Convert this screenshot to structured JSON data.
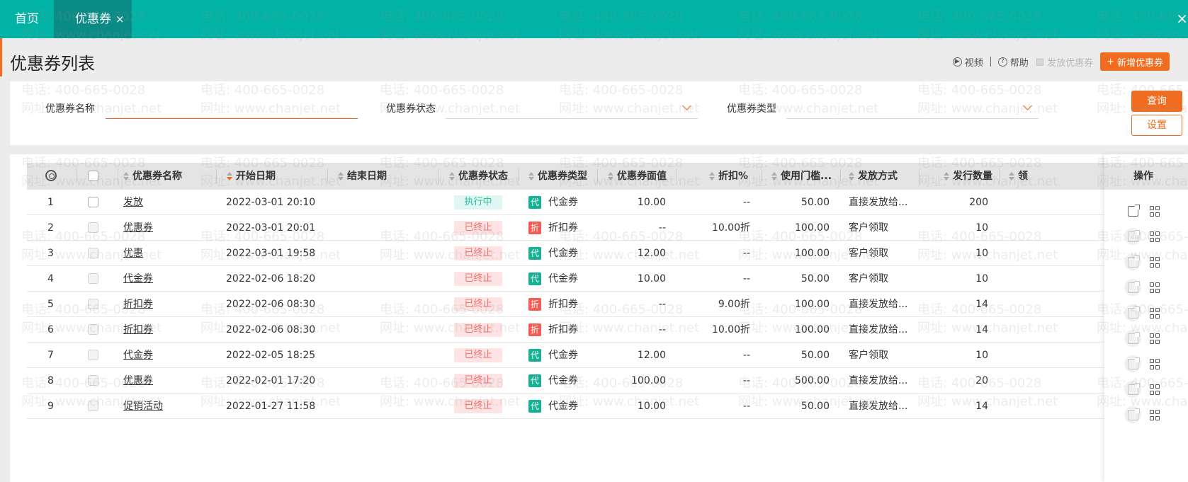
{
  "tabs": {
    "home": "首页",
    "active": "优惠券",
    "close": "×"
  },
  "top_close": "×",
  "page_title": "优惠券列表",
  "toolbar": {
    "video": "视频",
    "help": "帮助",
    "issue": "发放优惠券",
    "add": "新增优惠券"
  },
  "filters": {
    "name_label": "优惠券名称",
    "status_label": "优惠券状态",
    "type_label": "优惠券类型",
    "query": "查询",
    "settings": "设置"
  },
  "columns": {
    "name": "优惠券名称",
    "start": "开始日期",
    "end": "结束日期",
    "status": "优惠券状态",
    "type": "优惠券类型",
    "face": "优惠券面值",
    "discount": "折扣%",
    "threshold": "使用门槛...",
    "method": "发放方式",
    "qty": "发行数量",
    "extra": "领",
    "ops": "操作"
  },
  "rows": [
    {
      "idx": "1",
      "name": "发放",
      "start": "2022-03-01 20:10",
      "status": "执行中",
      "status_kind": "run",
      "type_icon": "代",
      "type_kind": "dai",
      "type": "代金券",
      "face": "10.00",
      "discount": "--",
      "threshold": "50.00",
      "method": "直接发放给...",
      "qty": "200"
    },
    {
      "idx": "2",
      "name": "优惠券",
      "start": "2022-03-01 20:01",
      "status": "已终止",
      "status_kind": "stop",
      "type_icon": "折",
      "type_kind": "zhe",
      "type": "折扣券",
      "face": "--",
      "discount": "10.00折",
      "threshold": "100.00",
      "method": "客户领取",
      "qty": "10"
    },
    {
      "idx": "3",
      "name": "优惠",
      "start": "2022-03-01 19:58",
      "status": "已终止",
      "status_kind": "stop",
      "type_icon": "代",
      "type_kind": "dai",
      "type": "代金券",
      "face": "12.00",
      "discount": "--",
      "threshold": "100.00",
      "method": "客户领取",
      "qty": "10"
    },
    {
      "idx": "4",
      "name": "代金券",
      "start": "2022-02-06 18:20",
      "status": "已终止",
      "status_kind": "stop",
      "type_icon": "代",
      "type_kind": "dai",
      "type": "代金券",
      "face": "10.00",
      "discount": "--",
      "threshold": "50.00",
      "method": "客户领取",
      "qty": "10"
    },
    {
      "idx": "5",
      "name": "折扣券",
      "start": "2022-02-06 08:30",
      "status": "已终止",
      "status_kind": "stop",
      "type_icon": "折",
      "type_kind": "zhe",
      "type": "折扣券",
      "face": "--",
      "discount": "9.00折",
      "threshold": "100.00",
      "method": "直接发放给...",
      "qty": "14"
    },
    {
      "idx": "6",
      "name": "折扣券",
      "start": "2022-02-06 08:30",
      "status": "已终止",
      "status_kind": "stop",
      "type_icon": "折",
      "type_kind": "zhe",
      "type": "折扣券",
      "face": "--",
      "discount": "10.00折",
      "threshold": "100.00",
      "method": "直接发放给...",
      "qty": "14"
    },
    {
      "idx": "7",
      "name": "代金券",
      "start": "2022-02-05 18:25",
      "status": "已终止",
      "status_kind": "stop",
      "type_icon": "代",
      "type_kind": "dai",
      "type": "代金券",
      "face": "12.00",
      "discount": "--",
      "threshold": "50.00",
      "method": "客户领取",
      "qty": "10"
    },
    {
      "idx": "8",
      "name": "优惠券",
      "start": "2022-02-01 17:20",
      "status": "已终止",
      "status_kind": "stop",
      "type_icon": "代",
      "type_kind": "dai",
      "type": "代金券",
      "face": "100.00",
      "discount": "--",
      "threshold": "500.00",
      "method": "直接发放给...",
      "qty": "20"
    },
    {
      "idx": "9",
      "name": "促销活动",
      "start": "2022-01-27 11:58",
      "status": "已终止",
      "status_kind": "stop",
      "type_icon": "代",
      "type_kind": "dai",
      "type": "代金券",
      "face": "10.00",
      "discount": "--",
      "threshold": "50.00",
      "method": "直接发放给...",
      "qty": "14"
    }
  ],
  "watermark": {
    "phone": "电话: 400-665-0028",
    "site": "网址: www.chanjet.net"
  },
  "colors": {
    "topbar": "#00b3a4",
    "active_tab": "#0a8b86",
    "accent": "#f26c1f",
    "run": "#2fbf9f",
    "stop": "#f0706b"
  }
}
